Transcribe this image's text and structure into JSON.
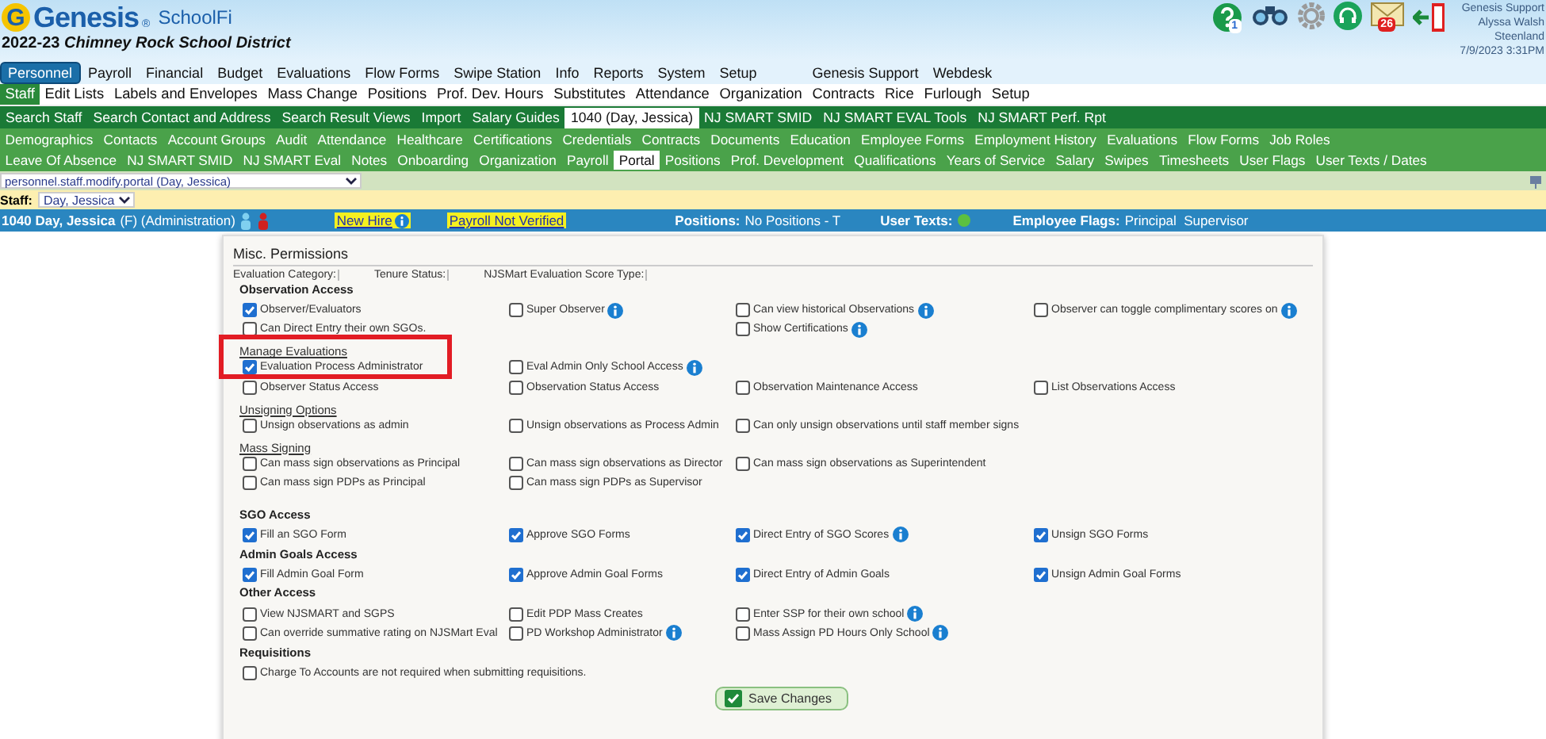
{
  "header": {
    "logo_letter": "G",
    "brand": "Genesis",
    "registered": "®",
    "product": "SchoolFi",
    "district": "2022-23 *Chimney Rock School District*",
    "help_badge": "1",
    "mail_badge": "26",
    "user_lines": [
      "Genesis Support",
      "Alyssa Walsh",
      "Steenland",
      "7/9/2023 3:31PM"
    ]
  },
  "main_menu": [
    {
      "label": "Personnel",
      "selected": true
    },
    {
      "label": "Payroll",
      "selected": false
    },
    {
      "label": "Financial",
      "selected": false
    },
    {
      "label": "Budget",
      "selected": false
    },
    {
      "label": "Evaluations",
      "selected": false
    },
    {
      "label": "Flow Forms",
      "selected": false
    },
    {
      "label": "Swipe Station",
      "selected": false
    },
    {
      "label": "Info",
      "selected": false
    },
    {
      "label": "Reports",
      "selected": false
    },
    {
      "label": "System",
      "selected": false
    },
    {
      "label": "Setup",
      "selected": false
    },
    {
      "label": "Genesis Support",
      "selected": false
    },
    {
      "label": "Webdesk",
      "selected": false
    }
  ],
  "sub_menu": [
    {
      "label": "Staff",
      "selected": true
    },
    {
      "label": "Edit Lists",
      "selected": false
    },
    {
      "label": "Labels and Envelopes",
      "selected": false
    },
    {
      "label": "Mass Change",
      "selected": false
    },
    {
      "label": "Positions",
      "selected": false
    },
    {
      "label": "Prof. Dev. Hours",
      "selected": false
    },
    {
      "label": "Substitutes",
      "selected": false
    },
    {
      "label": "Attendance",
      "selected": false
    },
    {
      "label": "Organization",
      "selected": false
    },
    {
      "label": "Contracts",
      "selected": false
    },
    {
      "label": "Rice",
      "selected": false
    },
    {
      "label": "Furlough",
      "selected": false
    },
    {
      "label": "Setup",
      "selected": false
    }
  ],
  "staff_tabs": [
    {
      "label": "Search Staff",
      "selected": false
    },
    {
      "label": "Search Contact and Address",
      "selected": false
    },
    {
      "label": "Search Result Views",
      "selected": false
    },
    {
      "label": "Import",
      "selected": false
    },
    {
      "label": "Salary Guides",
      "selected": false
    },
    {
      "label": "1040 (Day, Jessica)",
      "selected": true
    },
    {
      "label": "NJ SMART SMID",
      "selected": false
    },
    {
      "label": "NJ SMART EVAL Tools",
      "selected": false
    },
    {
      "label": "NJ SMART Perf. Rpt",
      "selected": false
    }
  ],
  "record_tabs": [
    [
      {
        "label": "Demographics",
        "selected": false
      },
      {
        "label": "Contacts",
        "selected": false
      },
      {
        "label": "Account Groups",
        "selected": false
      },
      {
        "label": "Audit",
        "selected": false
      },
      {
        "label": "Attendance",
        "selected": false
      },
      {
        "label": "Healthcare",
        "selected": false
      },
      {
        "label": "Certifications",
        "selected": false
      },
      {
        "label": "Credentials",
        "selected": false
      },
      {
        "label": "Contracts",
        "selected": false
      },
      {
        "label": "Documents",
        "selected": false
      },
      {
        "label": "Education",
        "selected": false
      },
      {
        "label": "Employee Forms",
        "selected": false
      },
      {
        "label": "Employment History",
        "selected": false
      },
      {
        "label": "Evaluations",
        "selected": false
      },
      {
        "label": "Flow Forms",
        "selected": false
      },
      {
        "label": "Job Roles",
        "selected": false
      }
    ],
    [
      {
        "label": "Leave Of Absence",
        "selected": false
      },
      {
        "label": "NJ SMART SMID",
        "selected": false
      },
      {
        "label": "NJ SMART Eval",
        "selected": false
      },
      {
        "label": "Notes",
        "selected": false
      },
      {
        "label": "Onboarding",
        "selected": false
      },
      {
        "label": "Organization",
        "selected": false
      },
      {
        "label": "Payroll",
        "selected": false
      },
      {
        "label": "Portal",
        "selected": true
      },
      {
        "label": "Positions",
        "selected": false
      },
      {
        "label": "Prof. Development",
        "selected": false
      },
      {
        "label": "Qualifications",
        "selected": false
      },
      {
        "label": "Years of Service",
        "selected": false
      },
      {
        "label": "Salary",
        "selected": false
      },
      {
        "label": "Swipes",
        "selected": false
      },
      {
        "label": "Timesheets",
        "selected": false
      },
      {
        "label": "User Flags",
        "selected": false
      },
      {
        "label": "User Texts / Dates",
        "selected": false
      }
    ]
  ],
  "page_select": {
    "value": "personnel.staff.modify.portal (Day, Jessica)"
  },
  "staff_select": {
    "label": "Staff:",
    "value": "Day, Jessica"
  },
  "info_bar": {
    "name": "1040 Day, Jessica",
    "details": "(F) (Administration)",
    "new_hire": "New Hire",
    "payroll": "Payroll Not Verified",
    "positions_label": "Positions:",
    "positions": "No Positions - T",
    "user_texts_label": "User Texts:",
    "flags_label": "Employee Flags:",
    "flags": "Principal  Supervisor"
  },
  "panel": {
    "title": "Misc. Permissions",
    "fields": [
      {
        "label": "Evaluation Category:"
      },
      {
        "label": "Tenure Status:"
      },
      {
        "label": "NJSMart Evaluation Score Type:"
      }
    ],
    "sections": [
      {
        "title": "Observation Access",
        "items": [
          {
            "kind": "row",
            "column_1": {
              "label": "Observer/Evaluators",
              "checked": true,
              "info": false
            },
            "column_2": {
              "label": "Super Observer",
              "checked": false,
              "info": true
            },
            "column_3": {
              "label": "Can view historical Observations",
              "checked": false,
              "info": true
            },
            "column_4": {
              "label": "Observer can toggle complimentary scores on",
              "checked": false,
              "info": true
            }
          },
          {
            "kind": "row",
            "column_1": {
              "label": "Can Direct Entry their own SGOs.",
              "checked": false,
              "info": false
            },
            "column_3": {
              "label": "Show Certifications",
              "checked": false,
              "info": true
            }
          },
          {
            "kind": "subheading",
            "label": "Manage Evaluations",
            "highlighted": true
          },
          {
            "kind": "row",
            "column_1": {
              "label": "Evaluation Process Administrator",
              "checked": true,
              "info": false
            },
            "column_2": {
              "label": "Eval Admin Only School Access",
              "checked": false,
              "info": true
            }
          },
          {
            "kind": "row",
            "column_1": {
              "label": "Observer Status Access",
              "checked": false,
              "info": false
            },
            "column_2": {
              "label": "Observation Status Access",
              "checked": false,
              "info": false
            },
            "column_3": {
              "label": "Observation Maintenance Access",
              "checked": false,
              "info": false
            },
            "column_4": {
              "label": "List Observations Access",
              "checked": false,
              "info": false
            }
          },
          {
            "kind": "subheading",
            "label": "Unsigning Options",
            "highlighted": false
          },
          {
            "kind": "row",
            "column_1": {
              "label": "Unsign observations as admin",
              "checked": false,
              "info": false
            },
            "column_2": {
              "label": "Unsign observations as Process Admin",
              "checked": false,
              "info": false
            },
            "column_3": {
              "label": "Can only unsign observations until staff member signs",
              "checked": false,
              "info": false
            }
          },
          {
            "kind": "subheading",
            "label": "Mass Signing",
            "highlighted": false
          },
          {
            "kind": "row",
            "column_1": {
              "label": "Can mass sign observations as Principal",
              "checked": false,
              "info": false
            },
            "column_2": {
              "label": "Can mass sign observations as Director",
              "checked": false,
              "info": false
            },
            "column_3": {
              "label": "Can mass sign observations as Superintendent",
              "checked": false,
              "info": false
            }
          },
          {
            "kind": "row",
            "column_1": {
              "label": "Can mass sign PDPs as Principal",
              "checked": false,
              "info": false
            },
            "column_2": {
              "label": "Can mass sign PDPs as Supervisor",
              "checked": false,
              "info": false
            }
          }
        ]
      },
      {
        "title": "SGO Access",
        "items": [
          {
            "kind": "row",
            "column_1": {
              "label": "Fill an SGO Form",
              "checked": true,
              "info": false
            },
            "column_2": {
              "label": "Approve SGO Forms",
              "checked": true,
              "info": false
            },
            "column_3": {
              "label": "Direct Entry of SGO Scores",
              "checked": true,
              "info": true
            },
            "column_4": {
              "label": "Unsign SGO Forms",
              "checked": true,
              "info": false
            }
          }
        ]
      },
      {
        "title": "Admin Goals Access",
        "items": [
          {
            "kind": "row",
            "column_1": {
              "label": "Fill Admin Goal Form",
              "checked": true,
              "info": false
            },
            "column_2": {
              "label": "Approve Admin Goal Forms",
              "checked": true,
              "info": false
            },
            "column_3": {
              "label": "Direct Entry of Admin Goals",
              "checked": true,
              "info": false
            },
            "column_4": {
              "label": "Unsign Admin Goal Forms",
              "checked": true,
              "info": false
            }
          }
        ]
      },
      {
        "title": "Other Access",
        "items": [
          {
            "kind": "row",
            "column_1": {
              "label": "View NJSMART and SGPS",
              "checked": false,
              "info": false
            },
            "column_2": {
              "label": "Edit PDP Mass Creates",
              "checked": false,
              "info": false
            },
            "column_3": {
              "label": "Enter SSP for their own school",
              "checked": false,
              "info": true
            }
          },
          {
            "kind": "row",
            "column_1": {
              "label": "Can override summative rating on NJSMart Eval",
              "checked": false,
              "info": false
            },
            "column_2": {
              "label": "PD Workshop Administrator",
              "checked": false,
              "info": true
            },
            "column_3": {
              "label": "Mass Assign PD Hours Only School",
              "checked": false,
              "info": true
            }
          }
        ]
      },
      {
        "title": "Requisitions",
        "items": [
          {
            "kind": "wide",
            "column_1": {
              "label": "Charge To Accounts are not required when submitting requisitions.",
              "checked": false,
              "info": false
            }
          }
        ]
      }
    ],
    "save_button": "Save Changes"
  }
}
